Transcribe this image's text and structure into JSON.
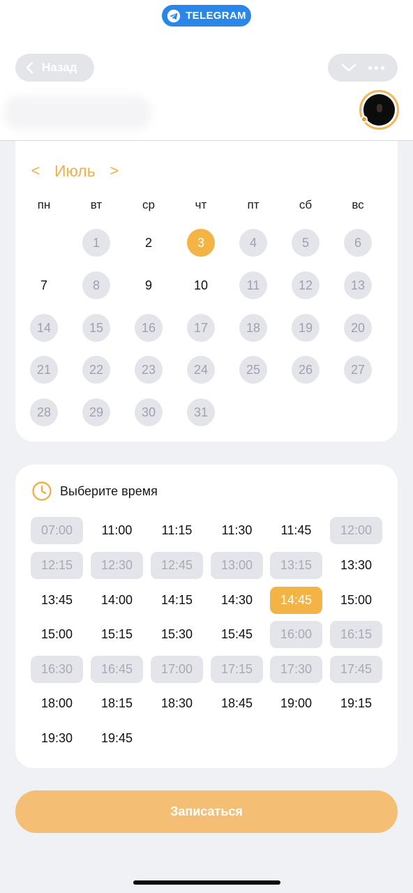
{
  "telegram": {
    "label": "TELEGRAM",
    "icon": "telegram-plane-icon"
  },
  "nav": {
    "back_label": "Назад",
    "back_icon": "chevron-left-icon",
    "collapse_icon": "chevron-down-icon",
    "more_icon": "more-dots-icon"
  },
  "calendar": {
    "month": "Июль",
    "prev": "<",
    "next": ">",
    "weekdays": [
      "пн",
      "вт",
      "ср",
      "чт",
      "пт",
      "сб",
      "вс"
    ],
    "first_weekday_offset": 1,
    "days": [
      {
        "label": "1",
        "state": "disabled"
      },
      {
        "label": "2",
        "state": "available"
      },
      {
        "label": "3",
        "state": "selected"
      },
      {
        "label": "4",
        "state": "disabled"
      },
      {
        "label": "5",
        "state": "disabled"
      },
      {
        "label": "6",
        "state": "disabled"
      },
      {
        "label": "7",
        "state": "available"
      },
      {
        "label": "8",
        "state": "disabled"
      },
      {
        "label": "9",
        "state": "available"
      },
      {
        "label": "10",
        "state": "available"
      },
      {
        "label": "11",
        "state": "disabled"
      },
      {
        "label": "12",
        "state": "disabled"
      },
      {
        "label": "13",
        "state": "disabled"
      },
      {
        "label": "14",
        "state": "disabled"
      },
      {
        "label": "15",
        "state": "disabled"
      },
      {
        "label": "16",
        "state": "disabled"
      },
      {
        "label": "17",
        "state": "disabled"
      },
      {
        "label": "18",
        "state": "disabled"
      },
      {
        "label": "19",
        "state": "disabled"
      },
      {
        "label": "20",
        "state": "disabled"
      },
      {
        "label": "21",
        "state": "disabled"
      },
      {
        "label": "22",
        "state": "disabled"
      },
      {
        "label": "23",
        "state": "disabled"
      },
      {
        "label": "24",
        "state": "disabled"
      },
      {
        "label": "25",
        "state": "disabled"
      },
      {
        "label": "26",
        "state": "disabled"
      },
      {
        "label": "27",
        "state": "disabled"
      },
      {
        "label": "28",
        "state": "disabled"
      },
      {
        "label": "29",
        "state": "disabled"
      },
      {
        "label": "30",
        "state": "disabled"
      },
      {
        "label": "31",
        "state": "disabled"
      }
    ]
  },
  "time": {
    "header": "Выберите время",
    "icon": "clock-icon",
    "slots": [
      {
        "label": "07:00",
        "state": "disabled"
      },
      {
        "label": "11:00",
        "state": "available"
      },
      {
        "label": "11:15",
        "state": "available"
      },
      {
        "label": "11:30",
        "state": "available"
      },
      {
        "label": "11:45",
        "state": "available"
      },
      {
        "label": "12:00",
        "state": "disabled"
      },
      {
        "label": "12:15",
        "state": "disabled"
      },
      {
        "label": "12:30",
        "state": "disabled"
      },
      {
        "label": "12:45",
        "state": "disabled"
      },
      {
        "label": "13:00",
        "state": "disabled"
      },
      {
        "label": "13:15",
        "state": "disabled"
      },
      {
        "label": "13:30",
        "state": "available"
      },
      {
        "label": "13:45",
        "state": "available"
      },
      {
        "label": "14:00",
        "state": "available"
      },
      {
        "label": "14:15",
        "state": "available"
      },
      {
        "label": "14:30",
        "state": "available"
      },
      {
        "label": "14:45",
        "state": "selected"
      },
      {
        "label": "15:00",
        "state": "available"
      },
      {
        "label": "15:00",
        "state": "available"
      },
      {
        "label": "15:15",
        "state": "available"
      },
      {
        "label": "15:30",
        "state": "available"
      },
      {
        "label": "15:45",
        "state": "available"
      },
      {
        "label": "16:00",
        "state": "disabled"
      },
      {
        "label": "16:15",
        "state": "disabled"
      },
      {
        "label": "16:30",
        "state": "disabled"
      },
      {
        "label": "16:45",
        "state": "disabled"
      },
      {
        "label": "17:00",
        "state": "disabled"
      },
      {
        "label": "17:15",
        "state": "disabled"
      },
      {
        "label": "17:30",
        "state": "disabled"
      },
      {
        "label": "17:45",
        "state": "disabled"
      },
      {
        "label": "18:00",
        "state": "available"
      },
      {
        "label": "18:15",
        "state": "available"
      },
      {
        "label": "18:30",
        "state": "available"
      },
      {
        "label": "18:45",
        "state": "available"
      },
      {
        "label": "19:00",
        "state": "available"
      },
      {
        "label": "19:15",
        "state": "available"
      },
      {
        "label": "19:30",
        "state": "available"
      },
      {
        "label": "19:45",
        "state": "available"
      }
    ]
  },
  "submit": {
    "label": "Записаться"
  },
  "colors": {
    "accent": "#f3b445",
    "telegram_blue": "#2a87e8",
    "disabled_bg": "#e4e5eb",
    "submit_bg": "#f4bf75"
  }
}
